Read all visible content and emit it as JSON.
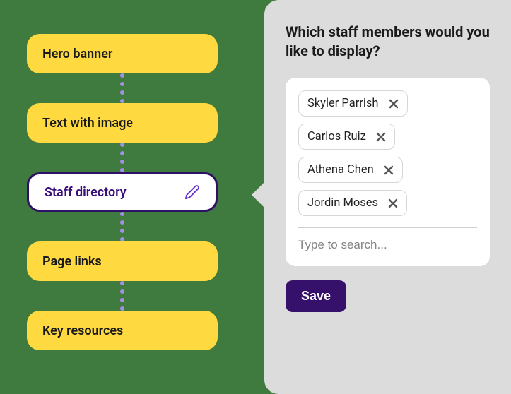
{
  "blocks": {
    "items": [
      {
        "label": "Hero banner"
      },
      {
        "label": "Text with image"
      },
      {
        "label": "Staff directory"
      },
      {
        "label": "Page links"
      },
      {
        "label": "Key resources"
      }
    ]
  },
  "panel": {
    "title": "Which staff members would you like to display?",
    "search_placeholder": "Type to search...",
    "save_label": "Save",
    "selected_staff": [
      {
        "name": "Skyler Parrish"
      },
      {
        "name": "Carlos Ruiz"
      },
      {
        "name": "Athena Chen"
      },
      {
        "name": "Jordin Moses"
      }
    ]
  },
  "colors": {
    "accent_yellow": "#ffd940",
    "accent_purple": "#35116b",
    "background_green": "#3f7a3f"
  }
}
